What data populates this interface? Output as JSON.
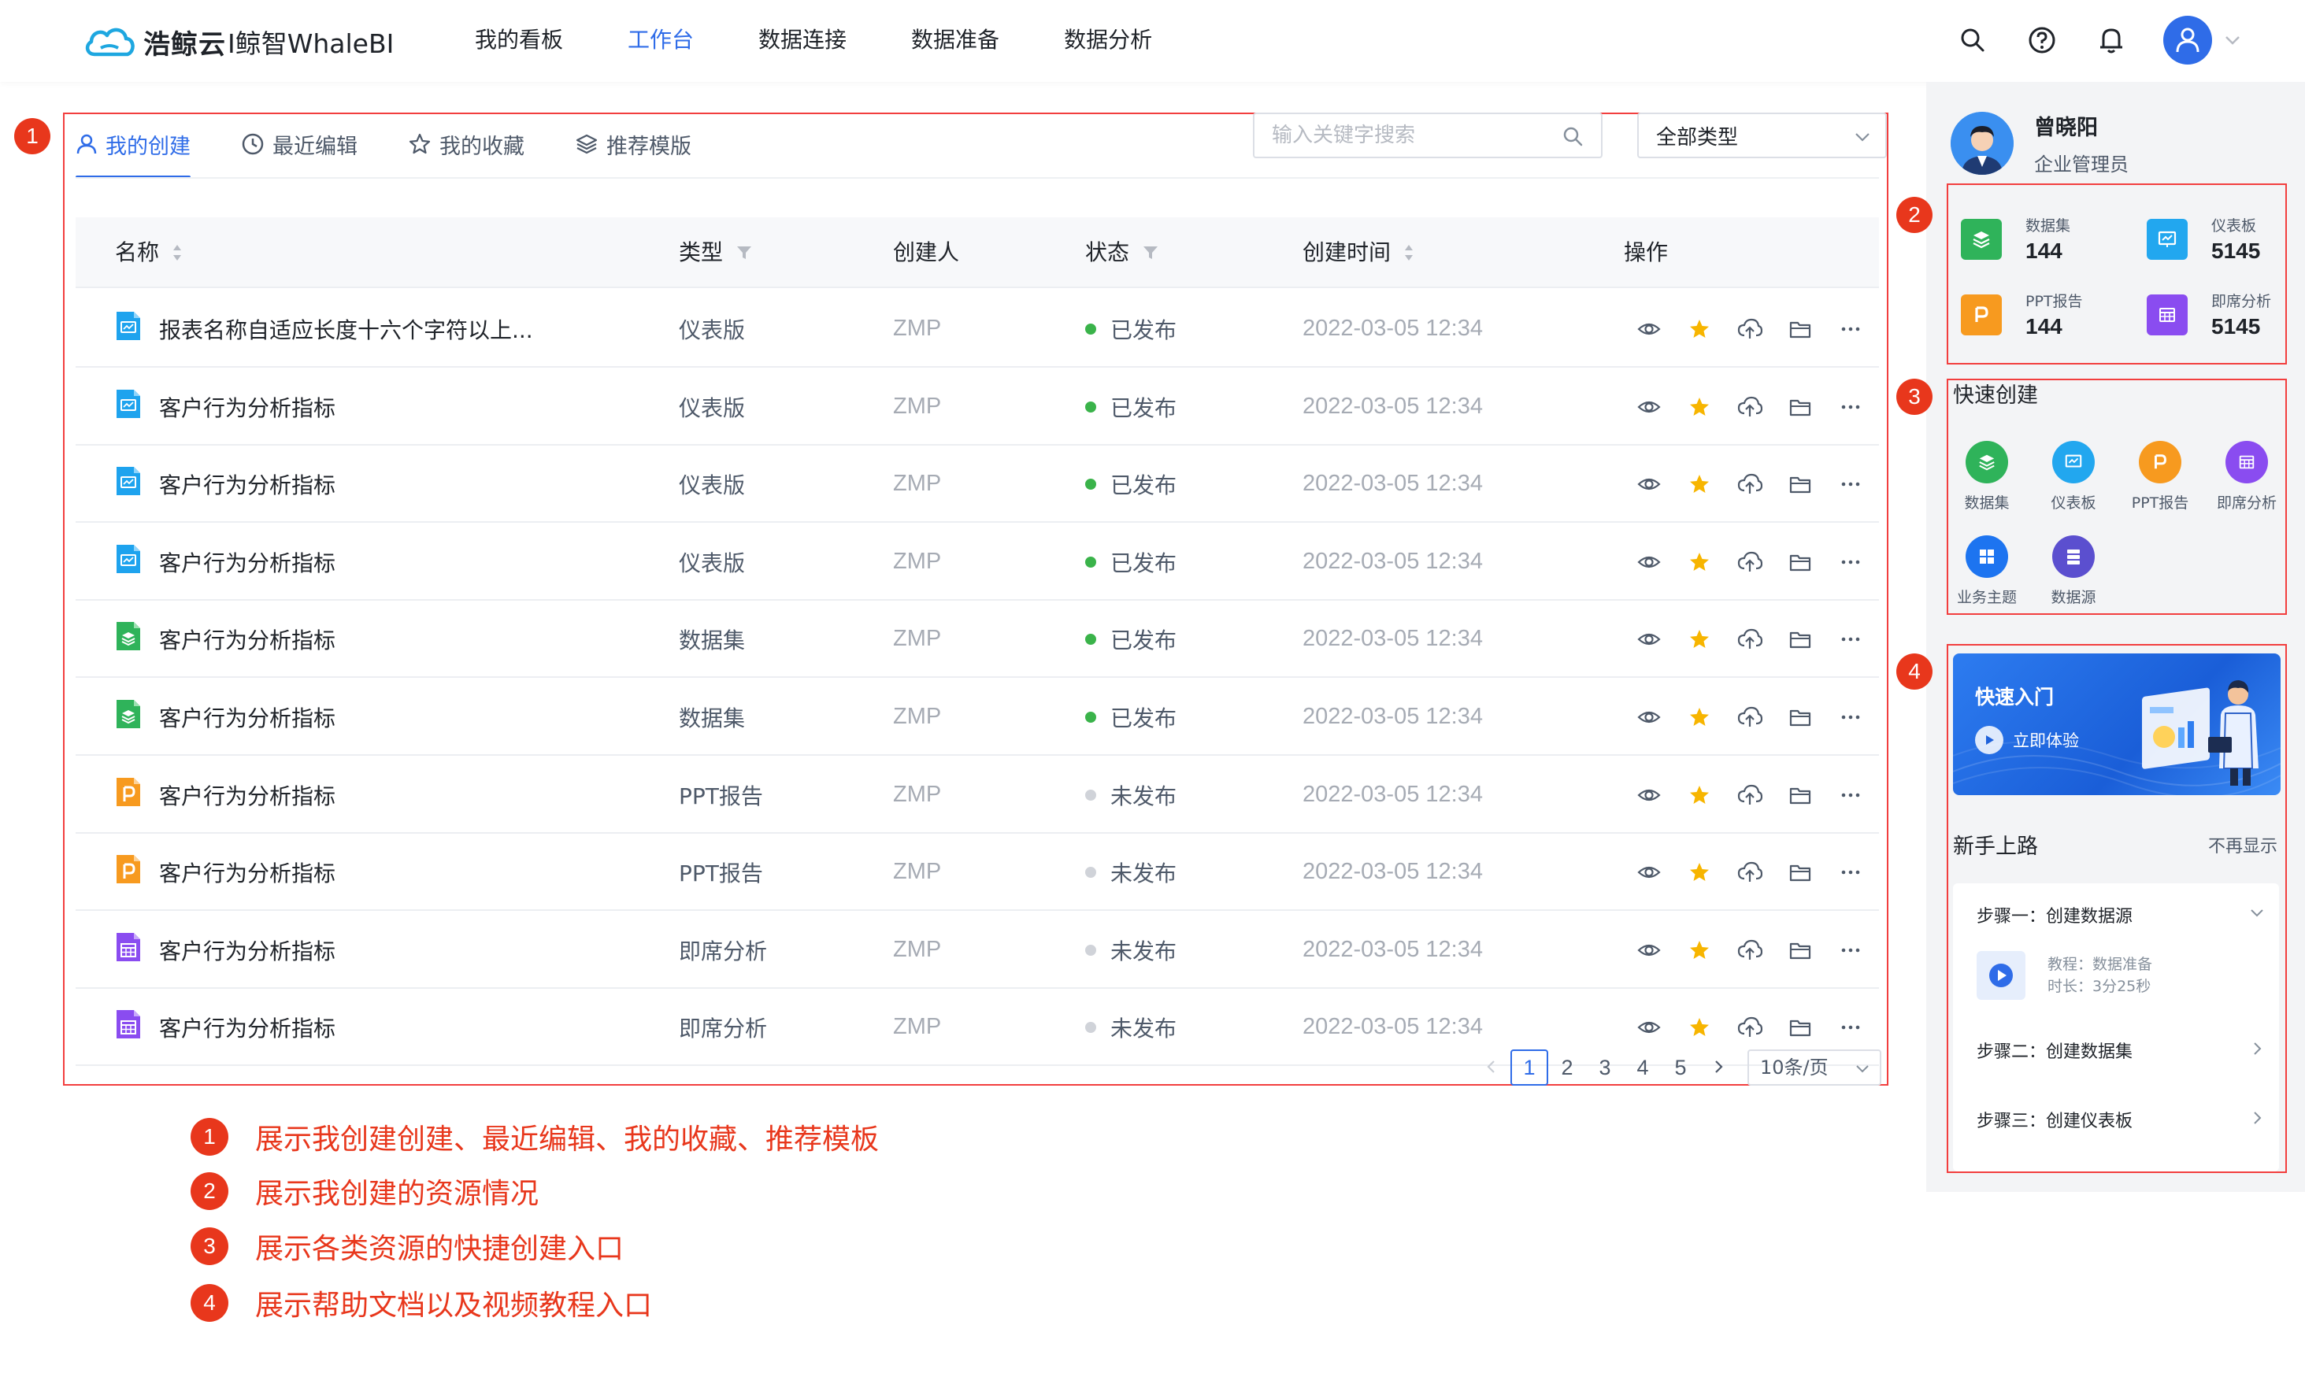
{
  "header": {
    "logo_brand": "浩鲸云",
    "logo_product": "I鲸智WhaleBI",
    "nav": [
      {
        "label": "我的看板",
        "active": false
      },
      {
        "label": "工作台",
        "active": true
      },
      {
        "label": "数据连接",
        "active": false
      },
      {
        "label": "数据准备",
        "active": false
      },
      {
        "label": "数据分析",
        "active": false
      }
    ],
    "icons": [
      "search-icon",
      "help-icon",
      "bell-icon",
      "user-avatar",
      "chevron-down-icon"
    ]
  },
  "markers": [
    "1",
    "2",
    "3",
    "4"
  ],
  "tabs": [
    {
      "label": "我的创建",
      "icon": "user-icon",
      "active": true
    },
    {
      "label": "最近编辑",
      "icon": "clock-icon",
      "active": false
    },
    {
      "label": "我的收藏",
      "icon": "star-icon",
      "active": false
    },
    {
      "label": "推荐模版",
      "icon": "layers-icon",
      "active": false
    }
  ],
  "search": {
    "placeholder": "输入关键字搜索"
  },
  "type_filter": {
    "value": "全部类型"
  },
  "table": {
    "columns": [
      "名称",
      "类型",
      "创建人",
      "状态",
      "创建时间",
      "操作"
    ],
    "rows": [
      {
        "name": "报表名称自适应长度十六个字符以上...",
        "type": "仪表版",
        "kind": "dashboard",
        "creator": "ZMP",
        "status": "已发布",
        "published": true,
        "time": "2022-03-05 12:34"
      },
      {
        "name": "客户行为分析指标",
        "type": "仪表版",
        "kind": "dashboard",
        "creator": "ZMP",
        "status": "已发布",
        "published": true,
        "time": "2022-03-05 12:34"
      },
      {
        "name": "客户行为分析指标",
        "type": "仪表版",
        "kind": "dashboard",
        "creator": "ZMP",
        "status": "已发布",
        "published": true,
        "time": "2022-03-05 12:34"
      },
      {
        "name": "客户行为分析指标",
        "type": "仪表版",
        "kind": "dashboard",
        "creator": "ZMP",
        "status": "已发布",
        "published": true,
        "time": "2022-03-05 12:34"
      },
      {
        "name": "客户行为分析指标",
        "type": "数据集",
        "kind": "dataset",
        "creator": "ZMP",
        "status": "已发布",
        "published": true,
        "time": "2022-03-05 12:34"
      },
      {
        "name": "客户行为分析指标",
        "type": "数据集",
        "kind": "dataset",
        "creator": "ZMP",
        "status": "已发布",
        "published": true,
        "time": "2022-03-05 12:34"
      },
      {
        "name": "客户行为分析指标",
        "type": "PPT报告",
        "kind": "ppt",
        "creator": "ZMP",
        "status": "未发布",
        "published": false,
        "time": "2022-03-05 12:34"
      },
      {
        "name": "客户行为分析指标",
        "type": "PPT报告",
        "kind": "ppt",
        "creator": "ZMP",
        "status": "未发布",
        "published": false,
        "time": "2022-03-05 12:34"
      },
      {
        "name": "客户行为分析指标",
        "type": "即席分析",
        "kind": "adhoc",
        "creator": "ZMP",
        "status": "未发布",
        "published": false,
        "time": "2022-03-05 12:34"
      },
      {
        "name": "客户行为分析指标",
        "type": "即席分析",
        "kind": "adhoc",
        "creator": "ZMP",
        "status": "未发布",
        "published": false,
        "time": "2022-03-05 12:34"
      }
    ],
    "row_actions": [
      "eye-icon",
      "star-icon",
      "cloud-upload-icon",
      "folder-icon",
      "more-icon"
    ]
  },
  "pagination": {
    "pages": [
      "1",
      "2",
      "3",
      "4",
      "5"
    ],
    "current": "1",
    "page_size": "10条/页"
  },
  "profile": {
    "name": "曾晓阳",
    "role": "企业管理员"
  },
  "stats": [
    {
      "label": "数据集",
      "value": "144",
      "color": "#2fb35a"
    },
    {
      "label": "仪表板",
      "value": "5145",
      "color": "#22a7ef"
    },
    {
      "label": "PPT报告",
      "value": "144",
      "color": "#f79a1f"
    },
    {
      "label": "即席分析",
      "value": "5145",
      "color": "#8a4cf0"
    }
  ],
  "quick_create": {
    "title": "快速创建",
    "items": [
      {
        "label": "数据集",
        "color": "#2fb35a"
      },
      {
        "label": "仪表板",
        "color": "#22a7ef"
      },
      {
        "label": "PPT报告",
        "color": "#f79a1f"
      },
      {
        "label": "即席分析",
        "color": "#8a4cf0"
      },
      {
        "label": "业务主题",
        "color": "#1d74f0"
      },
      {
        "label": "数据源",
        "color": "#5b4fcf"
      }
    ]
  },
  "banner": {
    "title": "快速入门",
    "button": "立即体验"
  },
  "guide": {
    "title": "新手上路",
    "hide_label": "不再显示",
    "steps": [
      "步骤一：创建数据源",
      "步骤二：创建数据集",
      "步骤三：创建仪表板"
    ],
    "tutorial_line1": "教程：数据准备",
    "tutorial_line2": "时长：3分25秒"
  },
  "annotations": [
    "展示我创建创建、最近编辑、我的收藏、推荐模板",
    "展示我创建的资源情况",
    "展示各类资源的快捷创建入口",
    "展示帮助文档以及视频教程入口"
  ],
  "colors": {
    "accent": "#2f6ce8",
    "annotation_red": "#e8371c",
    "published": "#3ab34a",
    "unpublished": "#d0d3d9",
    "star": "#f7b500"
  }
}
